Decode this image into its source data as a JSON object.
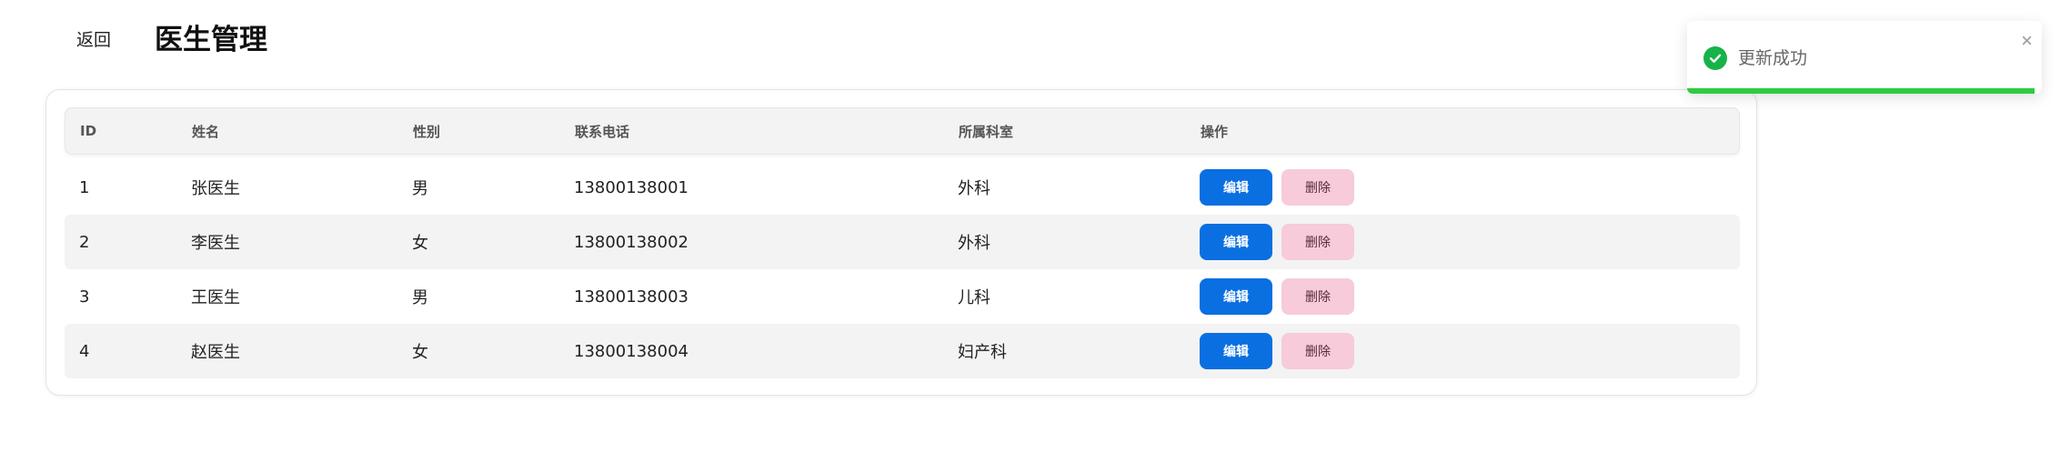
{
  "header": {
    "back_label": "返回",
    "title": "医生管理"
  },
  "table": {
    "columns": [
      "ID",
      "姓名",
      "性别",
      "联系电话",
      "所属科室",
      "操作"
    ],
    "rows": [
      {
        "id": "1",
        "name": "张医生",
        "gender": "男",
        "phone": "13800138001",
        "department": "外科"
      },
      {
        "id": "2",
        "name": "李医生",
        "gender": "女",
        "phone": "13800138002",
        "department": "外科"
      },
      {
        "id": "3",
        "name": "王医生",
        "gender": "男",
        "phone": "13800138003",
        "department": "儿科"
      },
      {
        "id": "4",
        "name": "赵医生",
        "gender": "女",
        "phone": "13800138004",
        "department": "妇产科"
      }
    ],
    "edit_label": "编辑",
    "delete_label": "删除"
  },
  "toast": {
    "message": "更新成功",
    "close_glyph": "×",
    "icon": "check-circle-icon",
    "progress_fraction": 0.98
  },
  "colors": {
    "edit_button": "#0a6fe0",
    "delete_button": "#f7cbd9",
    "success": "#17b24a",
    "progress": "#2ecc40"
  }
}
